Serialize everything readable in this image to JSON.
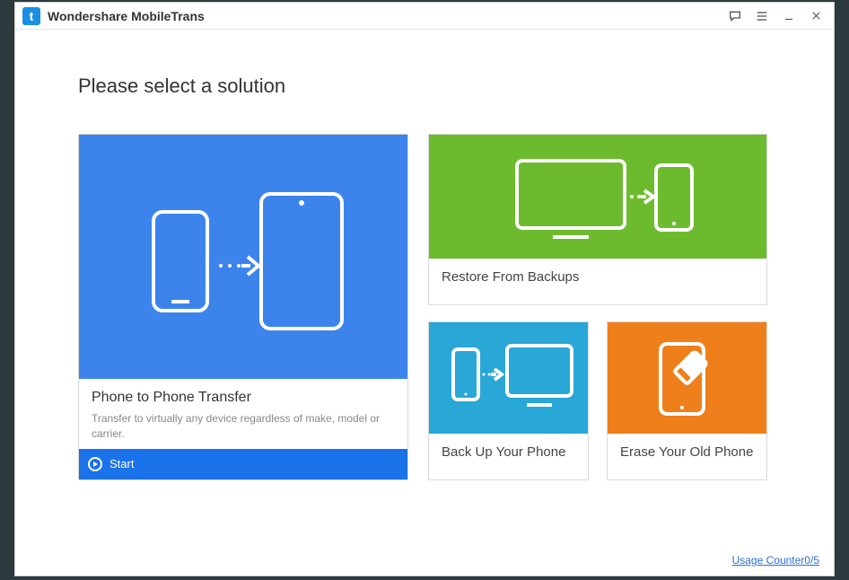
{
  "titlebar": {
    "title": "Wondershare MobileTrans"
  },
  "heading": "Please select a solution",
  "cards": {
    "main": {
      "title": "Phone to Phone Transfer",
      "desc": "Transfer to virtually any device regardless of make, model or carrier.",
      "start": "Start"
    },
    "restore": {
      "title": "Restore From Backups"
    },
    "backup": {
      "title": "Back Up Your Phone"
    },
    "erase": {
      "title": "Erase Your Old Phone"
    }
  },
  "footer": {
    "usage": "Usage Counter0/5"
  }
}
